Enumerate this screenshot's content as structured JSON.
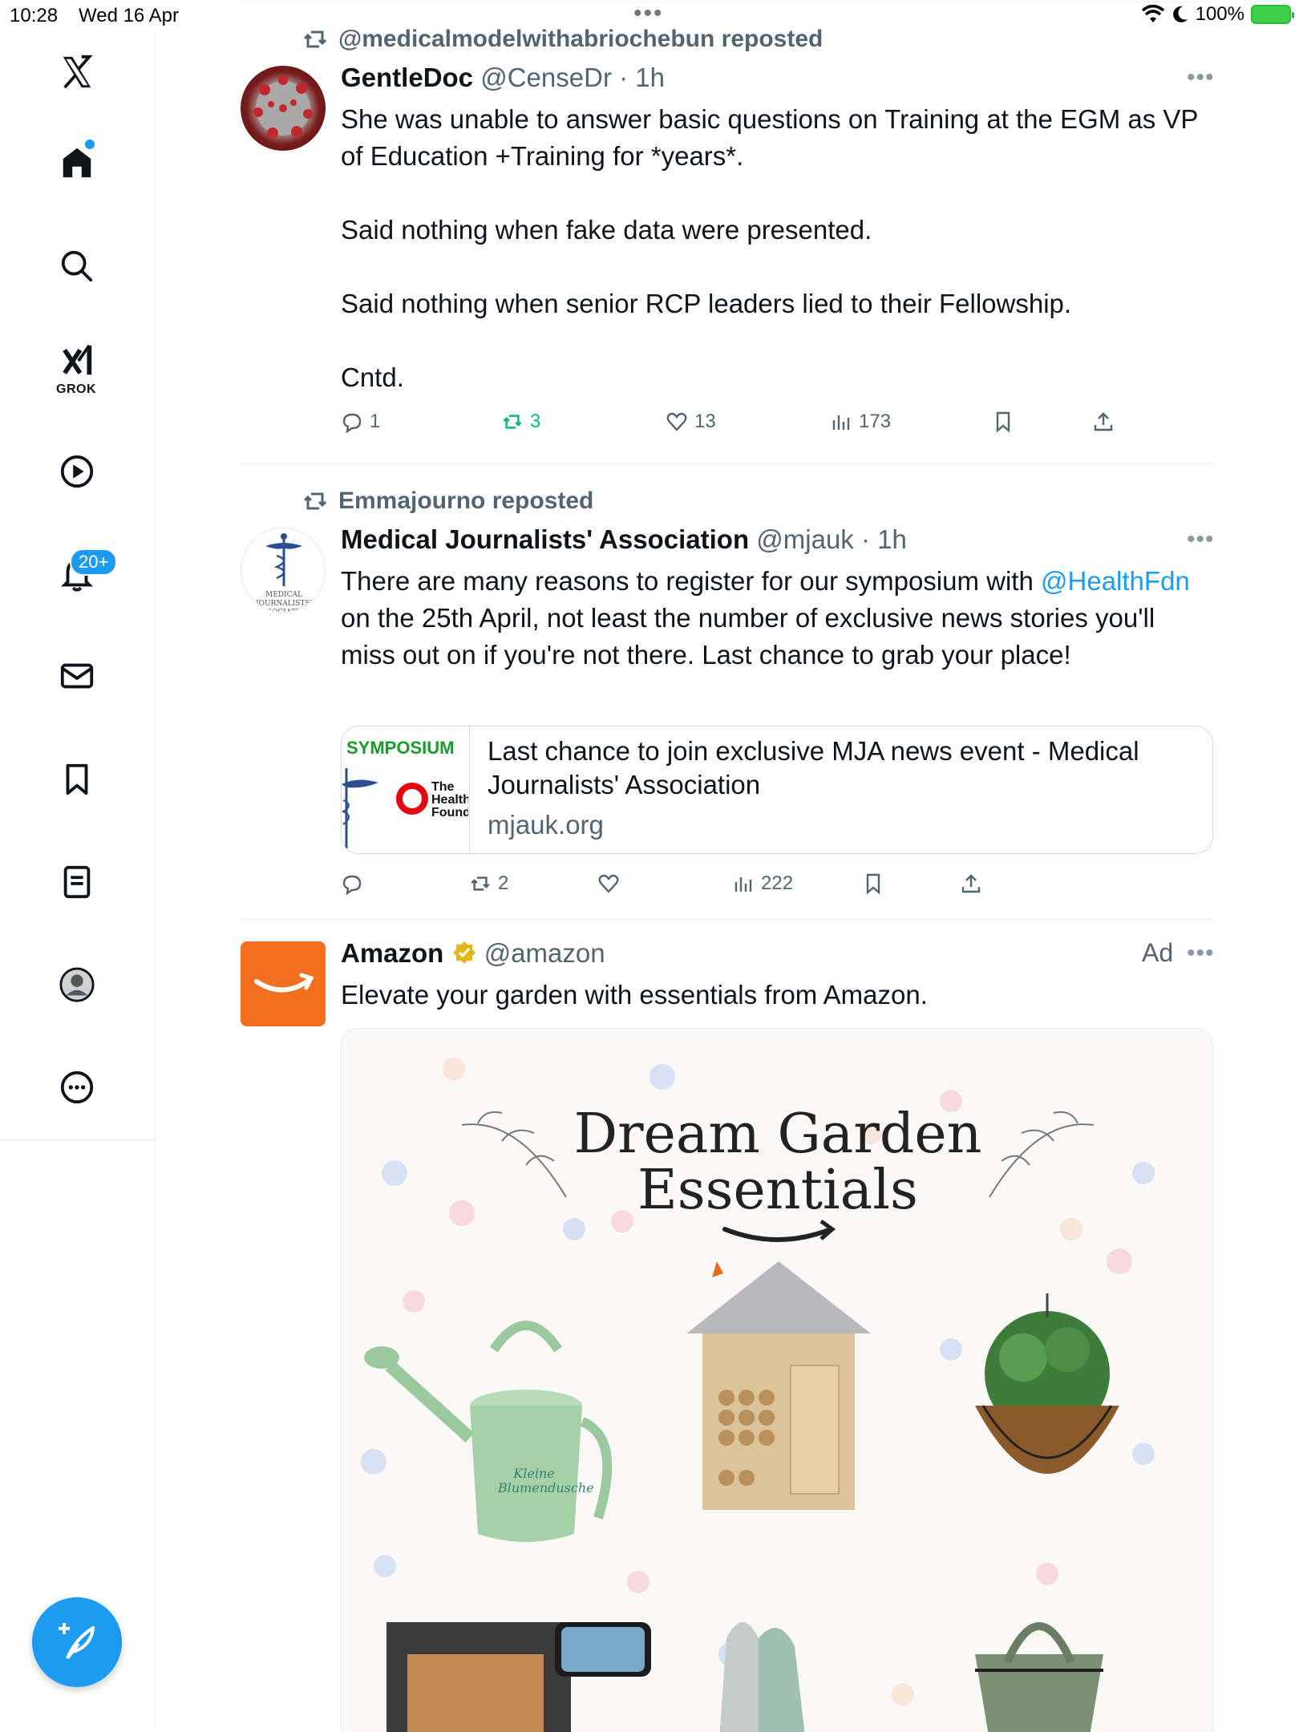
{
  "status_bar": {
    "time": "10:28",
    "date": "Wed 16 Apr",
    "battery": "100%"
  },
  "sidebar": {
    "grok_label": "GROK",
    "notifications_badge": "20+"
  },
  "tweets": [
    {
      "repost_by": "@medicalmodelwithabriochebun reposted",
      "name": "GentleDoc",
      "handle": "@CenseDr",
      "time": "· 1h",
      "paragraphs": [
        "She was unable to answer basic questions on Training at the EGM as VP of Education +Training for *years*.",
        "Said nothing when fake data were presented.",
        "Said nothing when senior RCP leaders lied to their Fellowship.",
        "Cntd."
      ],
      "replies": "1",
      "reposts": "3",
      "likes": "13",
      "views": "173"
    },
    {
      "repost_by": "Emmajourno reposted",
      "name": "Medical Journalists' Association",
      "handle": "@mjauk",
      "time": "· 1h",
      "text_before": "There are many reasons to register for our symposium with ",
      "mention": "@HealthFdn",
      "text_after": " on the 25th April, not least the number of exclusive news stories you'll miss out on if you're not there. Last chance to grab your place!",
      "avatar_text": "MEDICAL JOURNALISTS' ASSOCIATION",
      "card": {
        "thumb_label": "SYMPOSIUM",
        "thumb_logo": "The Health Found",
        "title": "Last chance to join exclusive MJA news event - Medical Journalists' Association",
        "domain": "mjauk.org"
      },
      "replies": "",
      "reposts": "2",
      "likes": "",
      "views": "222"
    },
    {
      "name": "Amazon",
      "handle": "@amazon",
      "ad_label": "Ad",
      "text": "Elevate your garden with essentials from Amazon.",
      "image": {
        "title_line1": "Dream Garden",
        "title_line2": "Essentials",
        "can_text": "Kleine Blumendusche"
      }
    }
  ],
  "colors": {
    "accent": "#1d9bf0",
    "repost_green": "#00ba7c",
    "amazon_orange": "#f26f21",
    "muted": "#536471"
  }
}
